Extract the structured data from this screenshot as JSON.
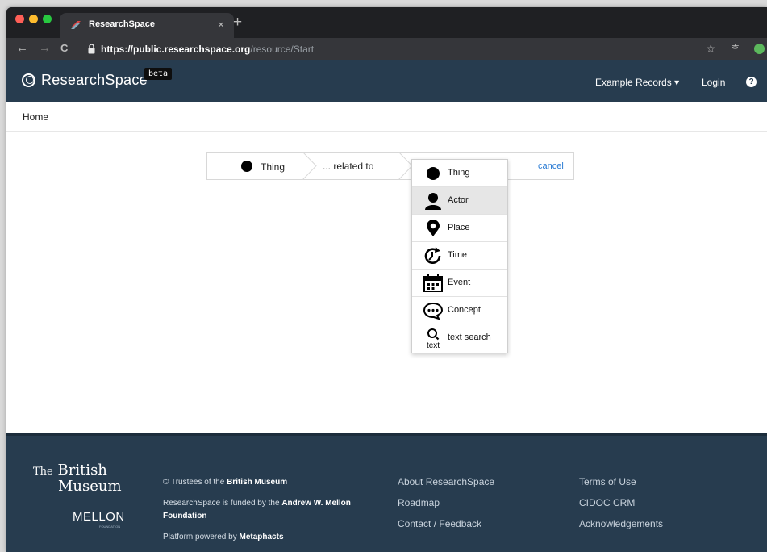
{
  "browser": {
    "tab_title": "ResearchSpace",
    "tab_close": "×",
    "new_tab": "+",
    "url_host": "https://public.researchspace.org",
    "url_path": "/resource/Start",
    "back": "←",
    "forward": "→",
    "reload": "C",
    "bookmark": "☆",
    "extension": "ᄒ"
  },
  "navbar": {
    "logo_text": "ResearchSpace",
    "beta_badge": "beta",
    "examples_label": "Example Records",
    "examples_caret": "▾",
    "login_label": "Login",
    "help_label": "?"
  },
  "breadcrumb": {
    "home": "Home"
  },
  "search_builder": {
    "domain_label": "Thing",
    "relation_label": "... related to",
    "cancel_label": "cancel"
  },
  "dropdown": {
    "items": [
      {
        "label": "Thing",
        "icon": "thing-icon"
      },
      {
        "label": "Actor",
        "icon": "actor-icon"
      },
      {
        "label": "Place",
        "icon": "place-icon"
      },
      {
        "label": "Time",
        "icon": "time-icon"
      },
      {
        "label": "Event",
        "icon": "event-icon"
      },
      {
        "label": "Concept",
        "icon": "concept-icon"
      },
      {
        "label": "text search",
        "icon": "text-search-icon"
      }
    ],
    "highlighted": "Actor",
    "text_icon_caption": "text"
  },
  "footer": {
    "bm_the": "The",
    "bm_british": "British",
    "bm_museum": "Museum",
    "mellon": "MELLON",
    "mellon_sub": "FOUNDATION",
    "copyright_prefix": "© Trustees of the",
    "copyright_strong": "British Museum",
    "funded_prefix": "ResearchSpace is funded by the",
    "funded_strong_1": "Andrew W. Mellon",
    "funded_strong_2": "Foundation",
    "powered_prefix": "Platform powered by",
    "powered_strong": "Metaphacts",
    "links_col1": [
      "About ResearchSpace",
      "Roadmap",
      "Contact / Feedback"
    ],
    "links_col2": [
      "Terms of Use",
      "CIDOC CRM",
      "Acknowledgements"
    ]
  },
  "colors": {
    "navbar_bg": "#273c4f",
    "link_blue": "#2a7bd4",
    "highlight_bg": "#e6e6e6"
  }
}
